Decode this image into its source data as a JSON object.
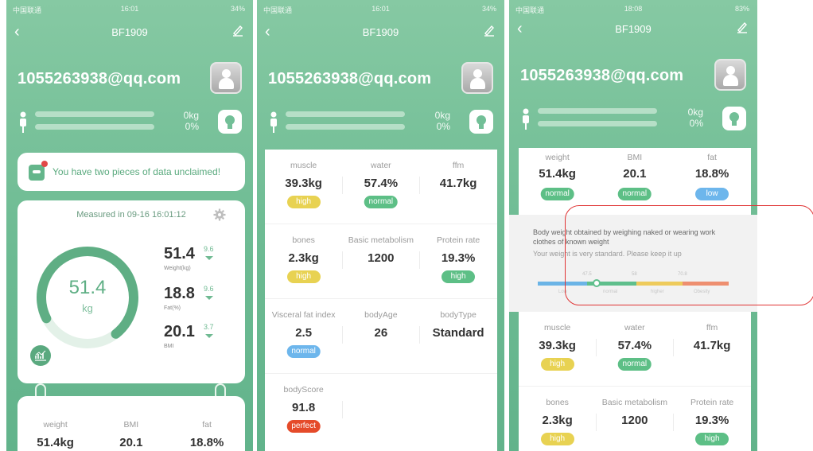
{
  "colors": {
    "high": "#e8d252",
    "normal": "#5dbf86",
    "low": "#6db6ec",
    "perfect": "#e54b2a",
    "scale_blue": "#6bb4e6",
    "scale_green": "#5fbf8c",
    "scale_yellow": "#eecb5c",
    "scale_orange": "#ee8f70"
  },
  "phones": [
    {
      "status": {
        "carrier": "中国联通",
        "time": "16:01",
        "battery": "34%"
      },
      "title": "BF1909",
      "email": "1055263938@qq.com",
      "weight_text": "0kg",
      "percent_text": "0%",
      "notice": "You have two pieces of data unclaimed!",
      "measured": "Measured in 09-16 16:01:12",
      "ring": {
        "value": "51.4",
        "unit": "kg",
        "progress": 0.72
      },
      "metrics": [
        {
          "value": "51.4",
          "delta": "9.6",
          "label": "Weight(kg)"
        },
        {
          "value": "18.8",
          "delta": "9.6",
          "label": "Fat(%)"
        },
        {
          "value": "20.1",
          "delta": "3.7",
          "label": "BMI"
        }
      ],
      "bottom": [
        {
          "label": "weight",
          "value": "51.4kg"
        },
        {
          "label": "BMI",
          "value": "20.1"
        },
        {
          "label": "fat",
          "value": "18.8%"
        }
      ]
    },
    {
      "status": {
        "carrier": "中国联通",
        "time": "16:01",
        "battery": "34%"
      },
      "title": "BF1909",
      "email": "1055263938@qq.com",
      "weight_text": "0kg",
      "percent_text": "0%",
      "rows": [
        [
          {
            "label": "muscle",
            "value": "39.3kg",
            "badge": "high",
            "tone": "high"
          },
          {
            "label": "water",
            "value": "57.4%",
            "badge": "normal",
            "tone": "normal"
          },
          {
            "label": "ffm",
            "value": "41.7kg"
          }
        ],
        [
          {
            "label": "bones",
            "value": "2.3kg",
            "badge": "high",
            "tone": "high"
          },
          {
            "label": "Basic metabolism",
            "value": "1200"
          },
          {
            "label": "Protein rate",
            "value": "19.3%",
            "badge": "high",
            "tone": "normal"
          }
        ],
        [
          {
            "label": "Visceral fat index",
            "value": "2.5",
            "badge": "normal",
            "tone": "low"
          },
          {
            "label": "bodyAge",
            "value": "26"
          },
          {
            "label": "bodyType",
            "value": "Standard"
          }
        ],
        [
          {
            "label": "bodyScore",
            "value": "91.8",
            "badge": "perfect",
            "tone": "perfect"
          }
        ]
      ]
    },
    {
      "status": {
        "carrier": "中国联通",
        "time": "18:08",
        "battery": "83%"
      },
      "title": "BF1909",
      "email": "1055263938@qq.com",
      "weight_text": "0kg",
      "percent_text": "0%",
      "top_row": [
        {
          "label": "weight",
          "value": "51.4kg",
          "badge": "normal",
          "tone": "normal"
        },
        {
          "label": "BMI",
          "value": "20.1",
          "badge": "normal",
          "tone": "normal"
        },
        {
          "label": "fat",
          "value": "18.8%",
          "badge": "low",
          "tone": "low"
        }
      ],
      "detail": {
        "text": "Body weight obtained by weighing naked or wearing work clothes of known weight",
        "sub": "Your weight is very standard. Please keep it up",
        "ticks": [
          "47.5",
          "58",
          "70.8"
        ],
        "segments": [
          "Low",
          "normal",
          "higher",
          "Obesity"
        ],
        "position": 0.31
      },
      "rows": [
        [
          {
            "label": "muscle",
            "value": "39.3kg",
            "badge": "high",
            "tone": "high"
          },
          {
            "label": "water",
            "value": "57.4%",
            "badge": "normal",
            "tone": "normal"
          },
          {
            "label": "ffm",
            "value": "41.7kg"
          }
        ],
        [
          {
            "label": "bones",
            "value": "2.3kg",
            "badge": "high",
            "tone": "high"
          },
          {
            "label": "Basic metabolism",
            "value": "1200"
          },
          {
            "label": "Protein rate",
            "value": "19.3%",
            "badge": "high",
            "tone": "normal"
          }
        ]
      ]
    }
  ]
}
